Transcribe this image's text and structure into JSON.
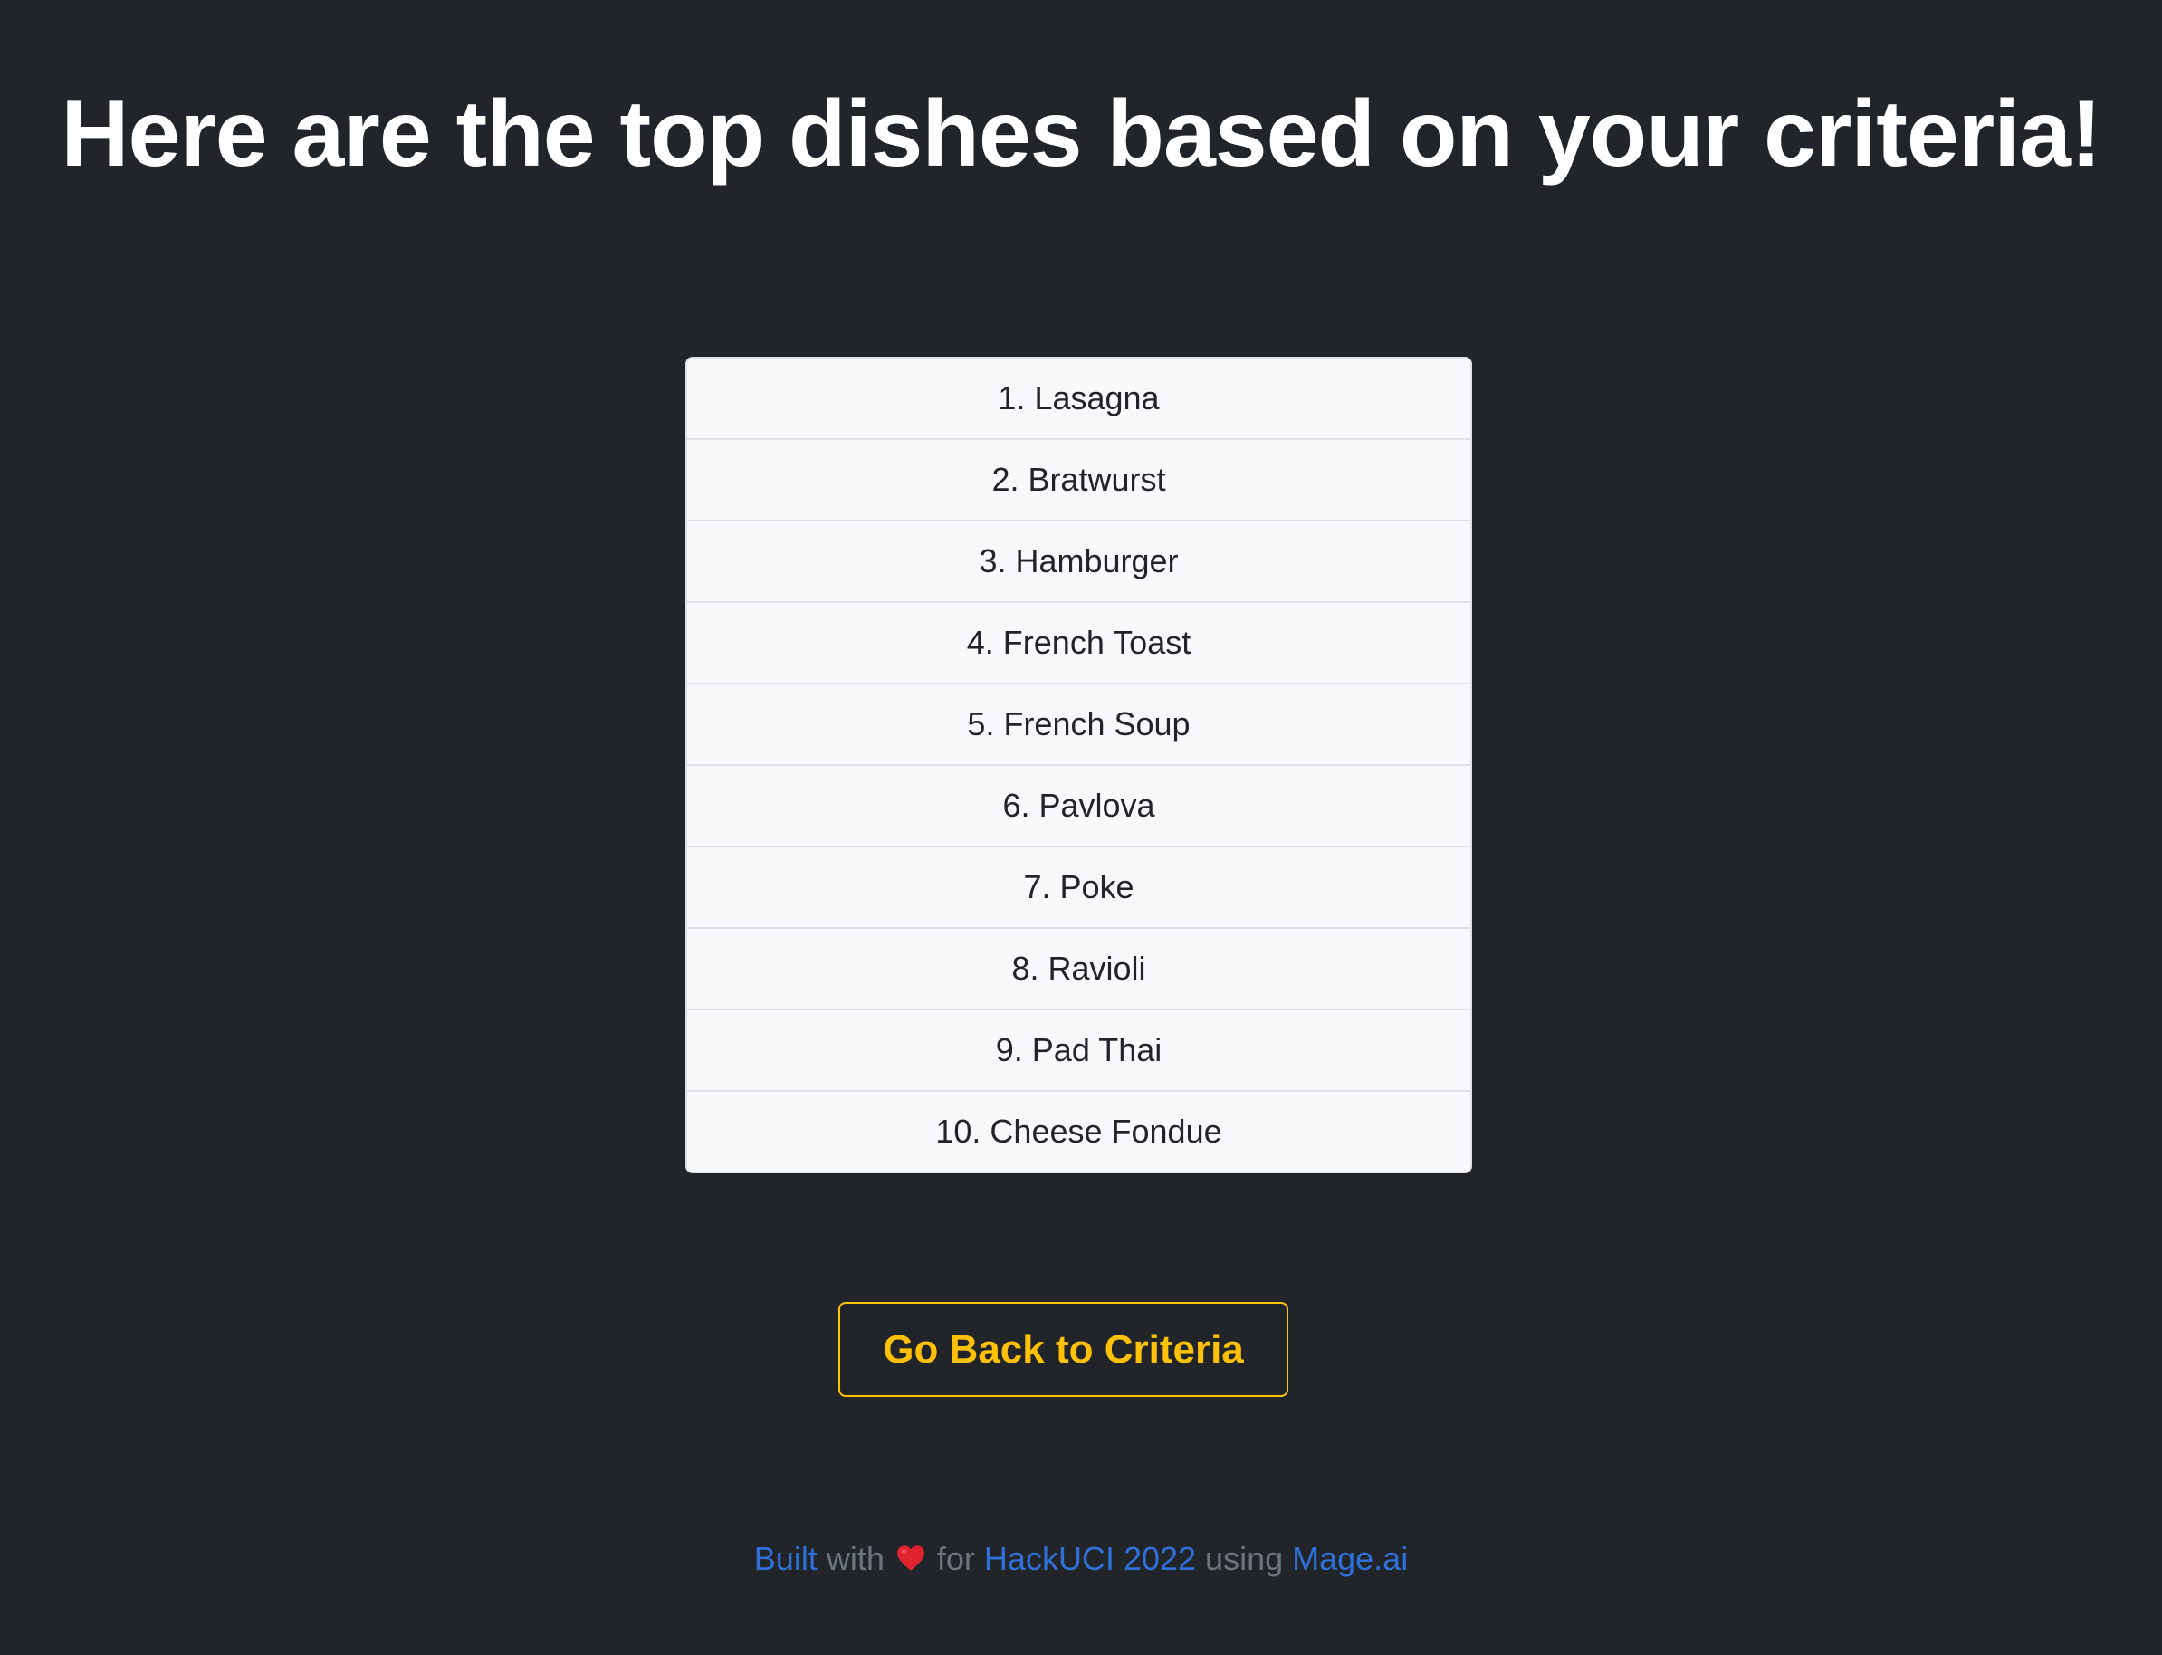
{
  "page": {
    "title": "Here are the top dishes based on your criteria!"
  },
  "dishes": [
    "1. Lasagna",
    "2. Bratwurst",
    "3. Hamburger",
    "4. French Toast",
    "5. French Soup",
    "6. Pavlova",
    "7. Poke",
    "8. Ravioli",
    "9. Pad Thai",
    "10. Cheese Fondue"
  ],
  "actions": {
    "back_label": "Go Back to Criteria"
  },
  "footer": {
    "built": "Built",
    "with": "with",
    "heart_icon": "heart-icon",
    "for": "for",
    "event": "HackUCI 2022",
    "using": "using",
    "tool": "Mage.ai"
  },
  "colors": {
    "background": "#212529",
    "accent": "#ffc107",
    "link": "#2f6fd6",
    "heart": "#e0242f"
  }
}
